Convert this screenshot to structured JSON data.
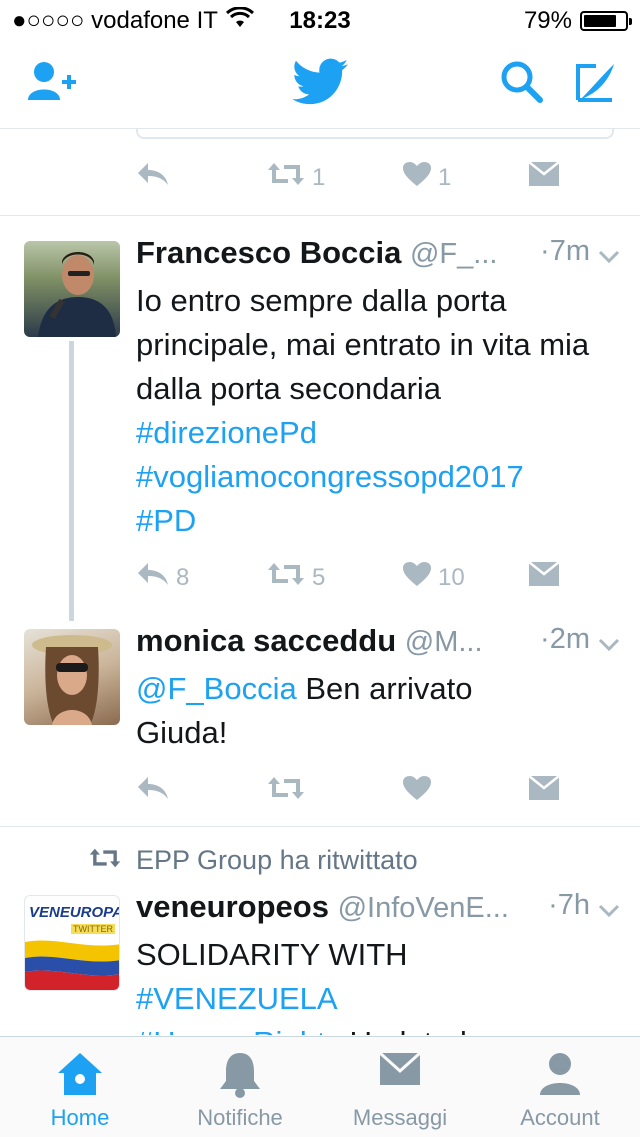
{
  "status_bar": {
    "carrier": "●○○○○ vodafone IT",
    "time": "18:23",
    "battery": "79%",
    "battery_level": 0.79
  },
  "colors": {
    "accent": "#1da1f2",
    "muted": "#aab8c2",
    "text": "#14171a",
    "secondary": "#657786"
  },
  "nav": {
    "icons": [
      "add-user-icon",
      "twitter-bird-icon",
      "search-icon",
      "compose-icon"
    ]
  },
  "top_actions": {
    "retweets": "1",
    "likes": "1"
  },
  "tweets": [
    {
      "name": "Francesco Boccia",
      "handle": "@F_...",
      "time": "·7m",
      "text": "Io entro sempre dalla porta principale, mai entrato in vita mia dalla porta secondaria",
      "hashtags": [
        "#direzionePd",
        "#vogliamocongressopd2017",
        "#PD"
      ],
      "replies": "8",
      "retweets": "5",
      "likes": "10"
    },
    {
      "name": "monica sacceddu",
      "handle": "@M...",
      "time": "·2m",
      "mention": "@F_Boccia",
      "text_line1": " Ben arrivato",
      "text_line2": "Giuda!"
    },
    {
      "retweeted_by": "EPP Group ha ritwittato",
      "name": "veneuropeos",
      "handle": "@InfoVenE...",
      "time": "·7h",
      "text": "SOLIDARITY WITH",
      "hashtag": "#VENEZUELA",
      "cut_line_link": "#HumanRights",
      "cut_line_text": " Updated",
      "avatar_brand": "VENEUROPA",
      "avatar_sub": "TWITTER"
    }
  ],
  "tabs": [
    {
      "label": "Home",
      "icon": "home-icon",
      "active": true
    },
    {
      "label": "Notifiche",
      "icon": "bell-icon",
      "active": false
    },
    {
      "label": "Messaggi",
      "icon": "envelope-icon",
      "active": false
    },
    {
      "label": "Account",
      "icon": "person-icon",
      "active": false
    }
  ]
}
